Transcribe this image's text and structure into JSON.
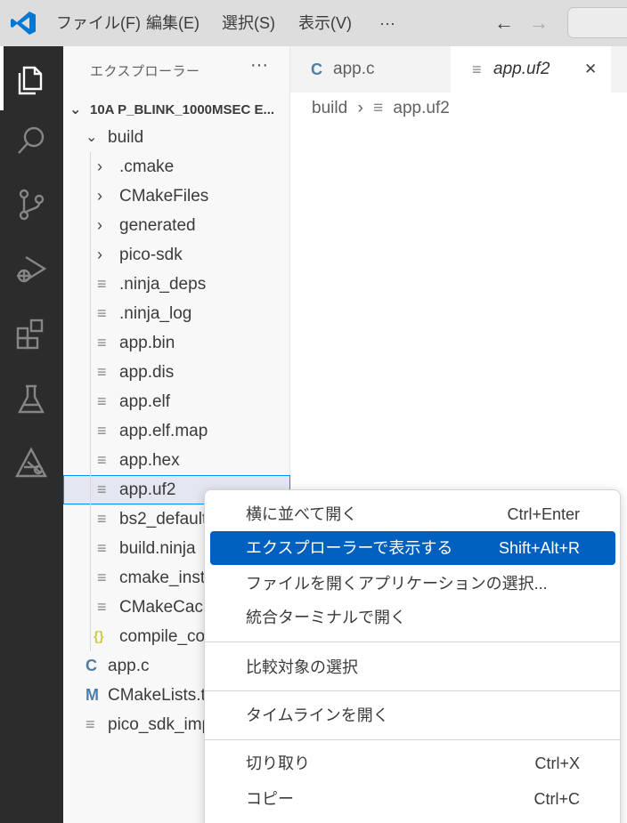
{
  "titlebar": {
    "menus": [
      "ファイル(F)",
      "編集(E)",
      "選択(S)",
      "表示(V)"
    ],
    "more": "···",
    "back": "←",
    "forward": "→"
  },
  "activitybar": {
    "icons": [
      "explorer-icon",
      "search-icon",
      "source-control-icon",
      "run-debug-icon",
      "extensions-icon",
      "testing-icon",
      "raspberry-pi-pico-icon"
    ]
  },
  "sidebar": {
    "title": "エクスプローラー",
    "more": "···",
    "root": "10A P_BLINK_1000MSEC E...",
    "tree": [
      {
        "label": "build",
        "icon": "chevron",
        "expanded": true
      },
      {
        "label": ".cmake",
        "icon": "chevron"
      },
      {
        "label": "CMakeFiles",
        "icon": "chevron"
      },
      {
        "label": "generated",
        "icon": "chevron"
      },
      {
        "label": "pico-sdk",
        "icon": "chevron"
      },
      {
        "label": ".ninja_deps",
        "icon": "file"
      },
      {
        "label": ".ninja_log",
        "icon": "file"
      },
      {
        "label": "app.bin",
        "icon": "file"
      },
      {
        "label": "app.dis",
        "icon": "file"
      },
      {
        "label": "app.elf",
        "icon": "file"
      },
      {
        "label": "app.elf.map",
        "icon": "file"
      },
      {
        "label": "app.hex",
        "icon": "file"
      },
      {
        "label": "app.uf2",
        "icon": "file",
        "selected": true
      },
      {
        "label": "bs2_default",
        "icon": "file"
      },
      {
        "label": "build.ninja",
        "icon": "file"
      },
      {
        "label": "cmake_insta",
        "icon": "file"
      },
      {
        "label": "CMakeCache",
        "icon": "file"
      },
      {
        "label": "compile_co",
        "icon": "json"
      },
      {
        "label": "app.c",
        "icon": "c"
      },
      {
        "label": "CMakeLists.t",
        "icon": "m"
      },
      {
        "label": "pico_sdk_imp",
        "icon": "file"
      }
    ],
    "icon_glyphs": {
      "c": "C",
      "m": "M",
      "json": "{}",
      "file": "≡"
    }
  },
  "editor": {
    "tabs": [
      {
        "label": "app.c",
        "icon": "C"
      },
      {
        "label": "app.uf2",
        "icon": "≡",
        "close": "✕"
      }
    ],
    "breadcrumb": {
      "folder": "build",
      "sep": "›",
      "file": "app.uf2",
      "icon": "≡"
    }
  },
  "context_menu": {
    "items": [
      {
        "label": "横に並べて開く",
        "shortcut": "Ctrl+Enter"
      },
      {
        "label": "エクスプローラーで表示する",
        "shortcut": "Shift+Alt+R",
        "highlighted": true
      },
      {
        "label": "ファイルを開くアプリケーションの選択...",
        "shortcut": ""
      },
      {
        "label": "統合ターミナルで開く",
        "shortcut": ""
      },
      {
        "label": "比較対象の選択",
        "shortcut": ""
      },
      {
        "label": "タイムラインを開く",
        "shortcut": ""
      },
      {
        "label": "切り取り",
        "shortcut": "Ctrl+X"
      },
      {
        "label": "コピー",
        "shortcut": "Ctrl+C"
      }
    ]
  },
  "colors": {
    "accent": "#0060c0",
    "activitybar": "#2c2c2c",
    "titlebar": "#dddddd",
    "vscode_blue": "#0078d4"
  }
}
